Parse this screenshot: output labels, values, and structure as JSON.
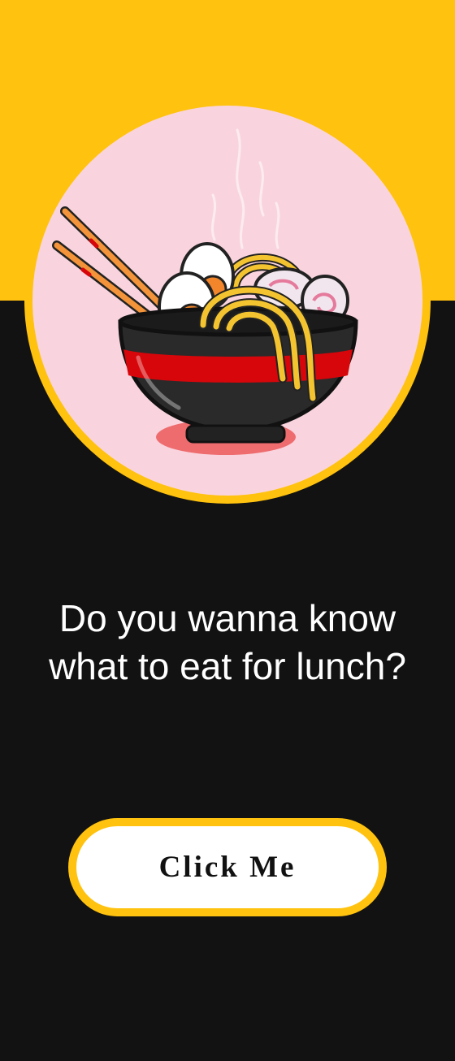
{
  "hero": {
    "illustration": "ramen-bowl-illustration",
    "icons": [
      "chopsticks-icon",
      "boiled-egg-icon",
      "noodles-icon",
      "fish-cake-icon",
      "steam-icon"
    ]
  },
  "headline": {
    "text": "Do you wanna know what to eat for lunch?"
  },
  "cta": {
    "label": "Click Me"
  },
  "colors": {
    "accent": "#FFC20E",
    "background": "#121212",
    "illustration_bg": "#F9D4DE",
    "button_bg": "#FFFFFF",
    "button_text": "#111111",
    "bowl_stripe": "#D7060A"
  }
}
